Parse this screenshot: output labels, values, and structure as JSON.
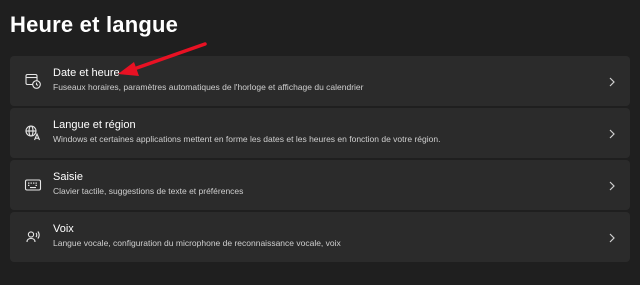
{
  "page": {
    "title": "Heure et langue"
  },
  "items": [
    {
      "title": "Date et heure",
      "description": "Fuseaux horaires, paramètres automatiques de l'horloge et affichage du calendrier",
      "icon": "calendar-clock-icon"
    },
    {
      "title": "Langue et région",
      "description": "Windows et certaines applications mettent en forme les dates et les heures en fonction de votre région.",
      "icon": "language-icon"
    },
    {
      "title": "Saisie",
      "description": "Clavier tactile, suggestions de texte et préférences",
      "icon": "keyboard-icon"
    },
    {
      "title": "Voix",
      "description": "Langue vocale, configuration du microphone de reconnaissance vocale, voix",
      "icon": "speech-icon"
    }
  ],
  "colors": {
    "background": "#1f1f1f",
    "card": "#2b2b2b",
    "annotation_arrow": "#e81123"
  }
}
